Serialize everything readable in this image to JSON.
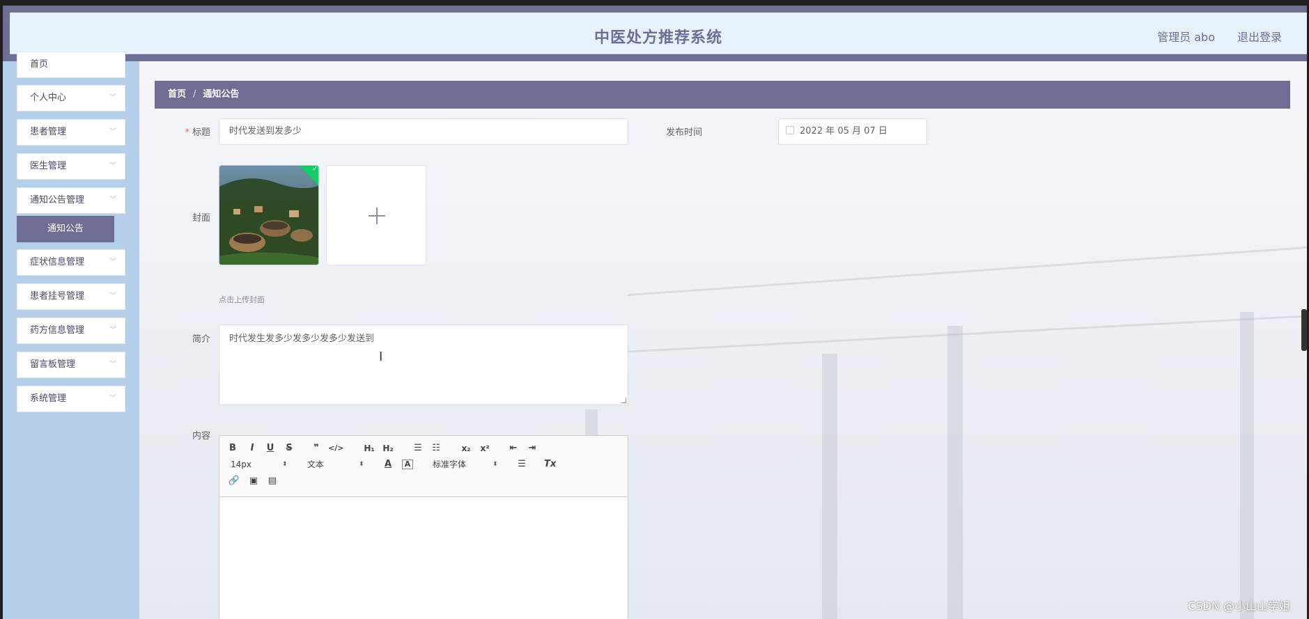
{
  "header": {
    "title": "中医处方推荐系统",
    "user": "管理员 abo",
    "logout": "退出登录"
  },
  "sidebar": {
    "items": [
      {
        "label": "首页"
      },
      {
        "label": "个人中心"
      },
      {
        "label": "患者管理"
      },
      {
        "label": "医生管理"
      },
      {
        "label": "通知公告管理"
      },
      {
        "label": "症状信息管理"
      },
      {
        "label": "患者挂号管理"
      },
      {
        "label": "药方信息管理"
      },
      {
        "label": "留言板管理"
      },
      {
        "label": "系统管理"
      }
    ],
    "active_sub": "通知公告"
  },
  "breadcrumb": {
    "home": "首页",
    "separator": "/",
    "current": "通知公告"
  },
  "form": {
    "title_label": "标题",
    "title_required": "*",
    "title_value": "时代发送到发多少",
    "publish_label": "发布时间",
    "publish_value": "2022 年 05 月 07 日",
    "cover_label": "封面",
    "cover_hint": "点击上传封面",
    "summary_label": "简介",
    "summary_value": "时代发生发多少发多少发多少发送到",
    "content_label": "内容"
  },
  "editor": {
    "font_size": "14px",
    "text_type": "文本",
    "font_family": "标准字体"
  },
  "watermark": "CSDN @小山山学姐",
  "colors": {
    "accent": "#6e6e94",
    "sidebar_bg": "#b6d0ea",
    "header_bg": "#e6f3fd"
  }
}
